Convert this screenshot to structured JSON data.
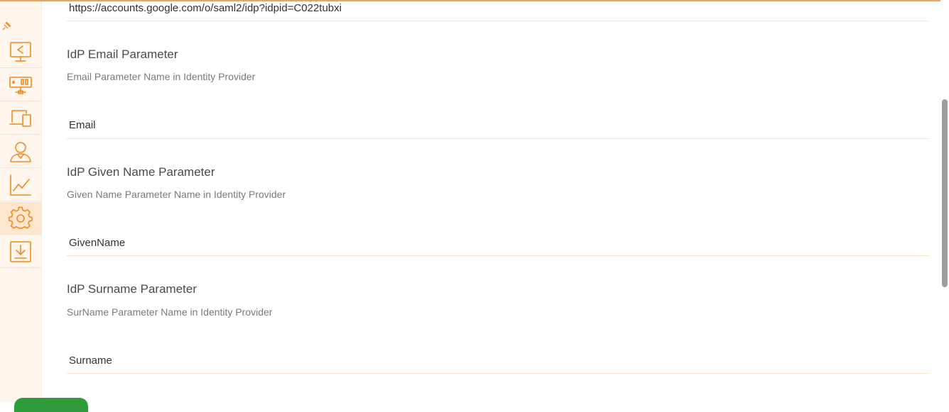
{
  "colors": {
    "accent": "#f08a1c",
    "sidebar_bg": "#fff6ee",
    "button_green": "#2e9c3a"
  },
  "sidebar": {
    "pin_icon": "pin-icon",
    "items": [
      {
        "icon": "share-screen-icon",
        "active": false
      },
      {
        "icon": "server-icon",
        "active": false
      },
      {
        "icon": "devices-icon",
        "active": false
      },
      {
        "icon": "user-icon",
        "active": false
      },
      {
        "icon": "chart-icon",
        "active": false
      },
      {
        "icon": "gear-icon",
        "active": true
      },
      {
        "icon": "download-icon",
        "active": false
      }
    ]
  },
  "form": {
    "sso_url_value": "https://accounts.google.com/o/saml2/idp?idpid=C022tubxi",
    "email": {
      "title": "IdP Email Parameter",
      "description": "Email Parameter Name in Identity Provider",
      "value": "Email"
    },
    "given_name": {
      "title": "IdP Given Name Parameter",
      "description": "Given Name Parameter Name in Identity Provider",
      "value": "GivenName"
    },
    "surname": {
      "title": "IdP Surname Parameter",
      "description": "SurName Parameter Name in Identity Provider",
      "value": "Surname"
    }
  }
}
